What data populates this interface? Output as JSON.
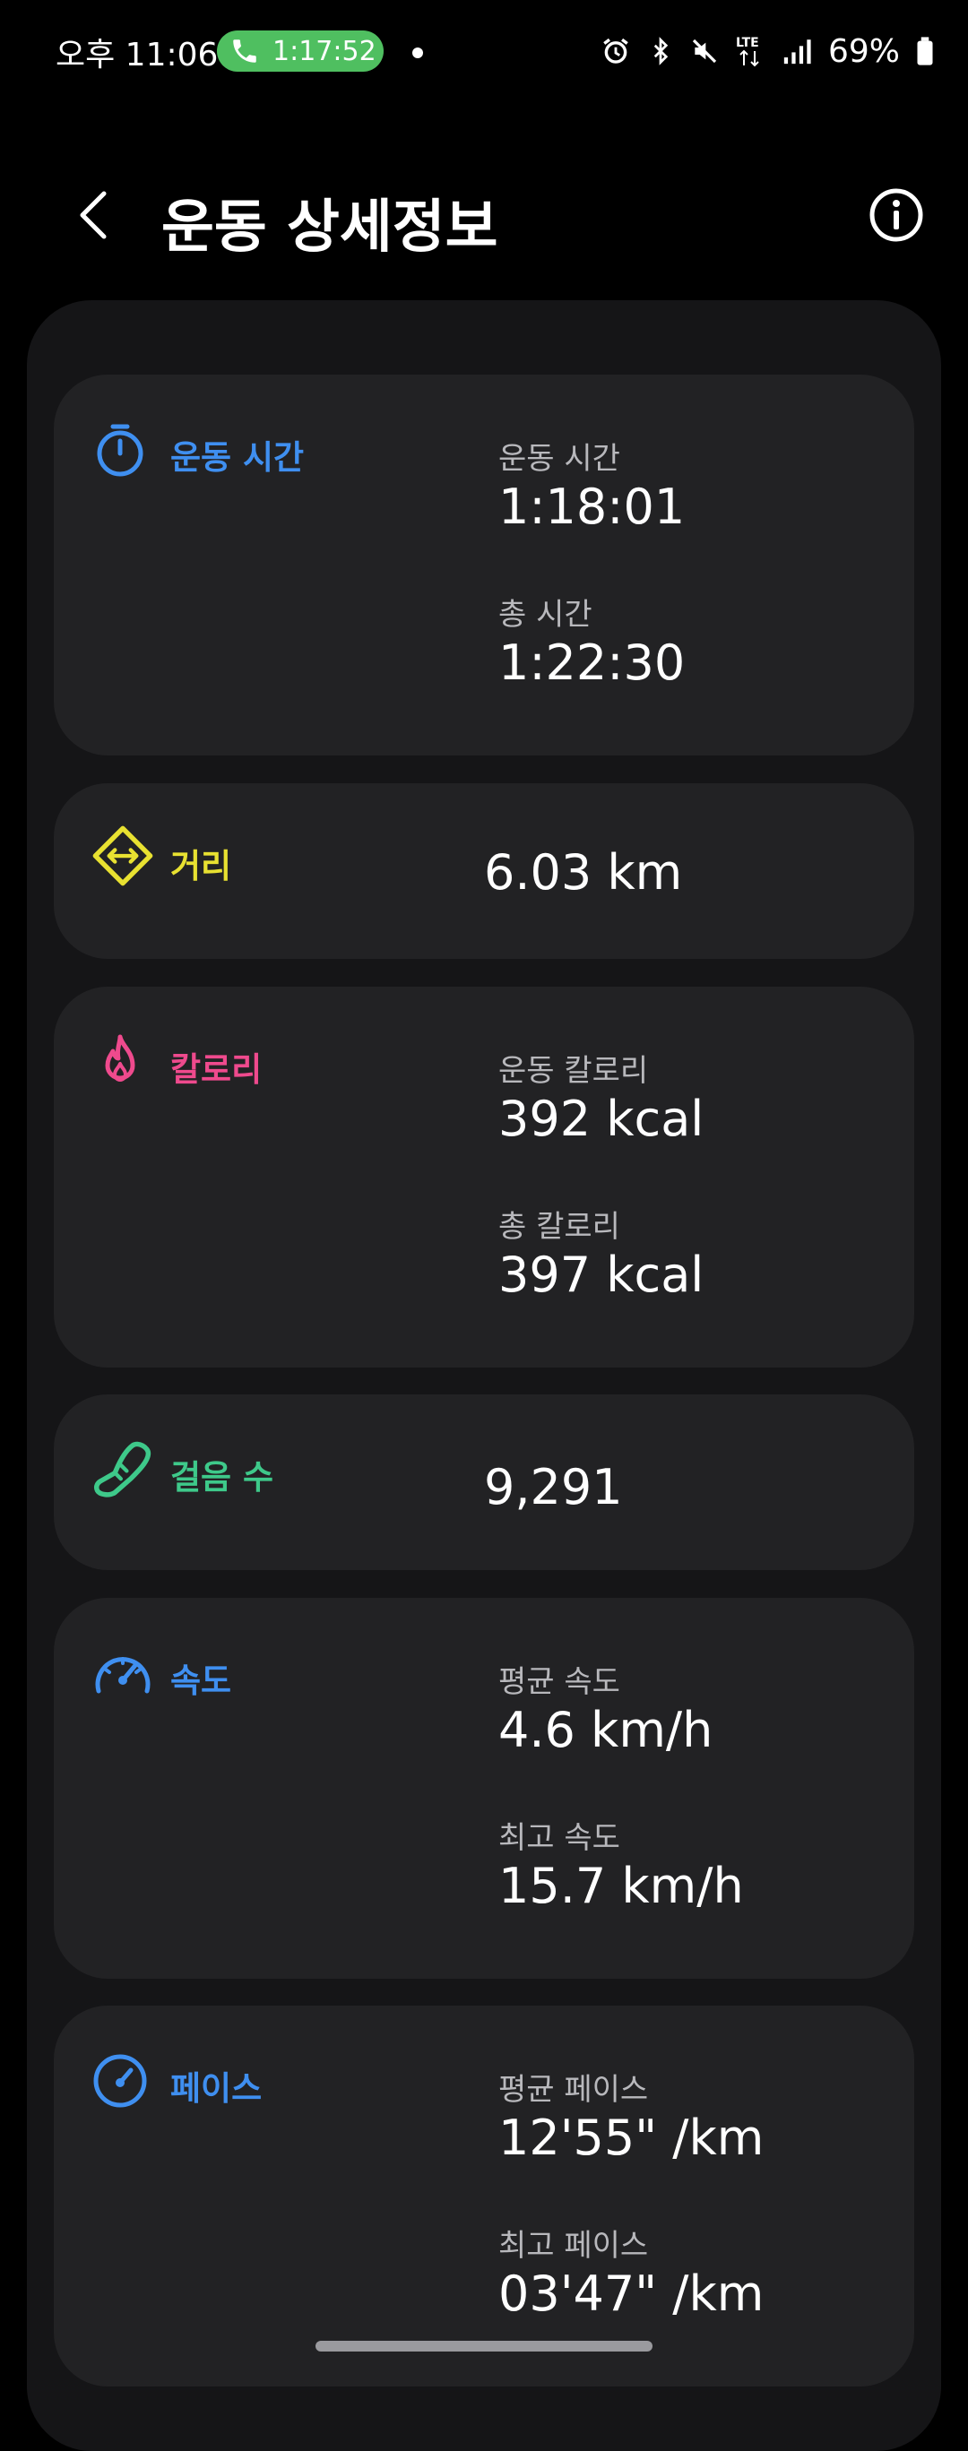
{
  "status_bar": {
    "time": "오후 11:06",
    "call_duration": "1:17:52",
    "battery": "69%"
  },
  "header": {
    "title": "운동 상세정보"
  },
  "cards": {
    "workout_time": {
      "label": "운동 시간",
      "color": "#3f8ff0",
      "icon": "stopwatch-icon",
      "rows": [
        {
          "sub": "운동 시간",
          "value": "1:18:01"
        },
        {
          "sub": "총 시간",
          "value": "1:22:30"
        }
      ]
    },
    "distance": {
      "label": "거리",
      "color": "#e8e131",
      "icon": "distance-icon",
      "value": "6.03 km"
    },
    "calories": {
      "label": "칼로리",
      "color": "#ef4a8d",
      "icon": "flame-icon",
      "rows": [
        {
          "sub": "운동 칼로리",
          "value": "392 kcal"
        },
        {
          "sub": "총 칼로리",
          "value": "397 kcal"
        }
      ]
    },
    "steps": {
      "label": "걸음 수",
      "color": "#3ec98a",
      "icon": "shoe-icon",
      "value": "9,291"
    },
    "speed": {
      "label": "속도",
      "color": "#3f8ff0",
      "icon": "speedometer-icon",
      "rows": [
        {
          "sub": "평균 속도",
          "value": "4.6 km/h"
        },
        {
          "sub": "최고 속도",
          "value": "15.7 km/h"
        }
      ]
    },
    "pace": {
      "label": "페이스",
      "color": "#3f8ff0",
      "icon": "pace-icon",
      "rows": [
        {
          "sub": "평균 페이스",
          "value": "12'55\" /km"
        },
        {
          "sub": "최고 페이스",
          "value": "03'47\" /km"
        }
      ]
    }
  }
}
